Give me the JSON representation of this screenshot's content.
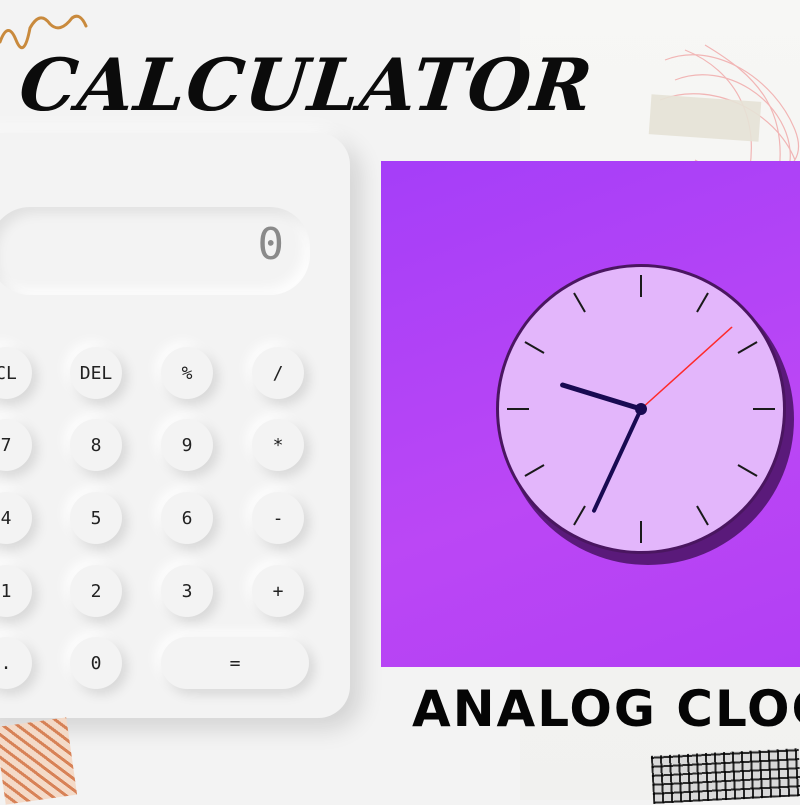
{
  "titles": {
    "calculator": "CALCULATOR",
    "clock": "ANALOG CLOC"
  },
  "calculator": {
    "display_value": "0",
    "keys": [
      {
        "label": "CL"
      },
      {
        "label": "DEL"
      },
      {
        "label": "%"
      },
      {
        "label": "/"
      },
      {
        "label": "7"
      },
      {
        "label": "8"
      },
      {
        "label": "9"
      },
      {
        "label": "*"
      },
      {
        "label": "4"
      },
      {
        "label": "5"
      },
      {
        "label": "6"
      },
      {
        "label": "-"
      },
      {
        "label": "1"
      },
      {
        "label": "2"
      },
      {
        "label": "3"
      },
      {
        "label": "+"
      },
      {
        "label": "."
      },
      {
        "label": "0"
      },
      {
        "label": "="
      }
    ]
  },
  "clock": {
    "time": {
      "hour": 9,
      "minute": 34,
      "second": 8
    },
    "colors": {
      "background": "#b040f7",
      "face": "#e3b6fb",
      "hands": "#190a52",
      "second_hand": "#ff2a2a"
    }
  },
  "colors": {
    "page": "#f3f3f3",
    "title_text": "#0b0b0b"
  }
}
